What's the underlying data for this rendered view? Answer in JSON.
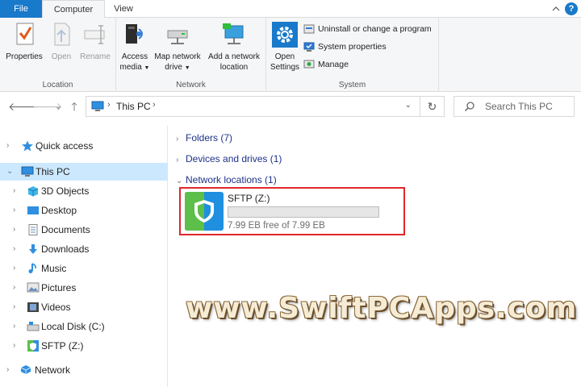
{
  "tabs": {
    "file": "File",
    "computer": "Computer",
    "view": "View",
    "help": "?"
  },
  "ribbon": {
    "location": {
      "label": "Location",
      "properties": "Properties",
      "open": "Open",
      "rename": "Rename"
    },
    "network": {
      "label": "Network",
      "access_media": "Access",
      "access_media_2": "media",
      "map_drive": "Map network",
      "map_drive_2": "drive",
      "add_location": "Add a network",
      "add_location_2": "location"
    },
    "system": {
      "label": "System",
      "open_settings": "Open",
      "open_settings_2": "Settings",
      "uninstall": "Uninstall or change a program",
      "system_properties": "System properties",
      "manage": "Manage"
    }
  },
  "address": {
    "crumb": "This PC"
  },
  "search": {
    "placeholder": "Search This PC"
  },
  "sidebar": {
    "items": [
      {
        "label": "Quick access",
        "icon": "star-icon"
      },
      {
        "label": "This PC",
        "icon": "computer-icon"
      },
      {
        "label": "3D Objects",
        "icon": "cube-icon"
      },
      {
        "label": "Desktop",
        "icon": "desktop-icon"
      },
      {
        "label": "Documents",
        "icon": "document-icon"
      },
      {
        "label": "Downloads",
        "icon": "download-icon"
      },
      {
        "label": "Music",
        "icon": "music-icon"
      },
      {
        "label": "Pictures",
        "icon": "picture-icon"
      },
      {
        "label": "Videos",
        "icon": "video-icon"
      },
      {
        "label": "Local Disk (C:)",
        "icon": "disk-icon"
      },
      {
        "label": "SFTP (Z:)",
        "icon": "sftp-drive-icon"
      },
      {
        "label": "Network",
        "icon": "network-icon"
      }
    ]
  },
  "content": {
    "folders": "Folders (7)",
    "devices": "Devices and drives (1)",
    "network_locations": "Network locations (1)",
    "drive": {
      "name": "SFTP (Z:)",
      "free_text": "7.99 EB free of 7.99 EB",
      "used_fraction": 0
    }
  },
  "watermark": "www.SwiftPCApps.com",
  "colors": {
    "accent": "#1979ca",
    "selection": "#cce8ff",
    "highlight_border": "#e0262b",
    "section_text": "#1e3287"
  }
}
